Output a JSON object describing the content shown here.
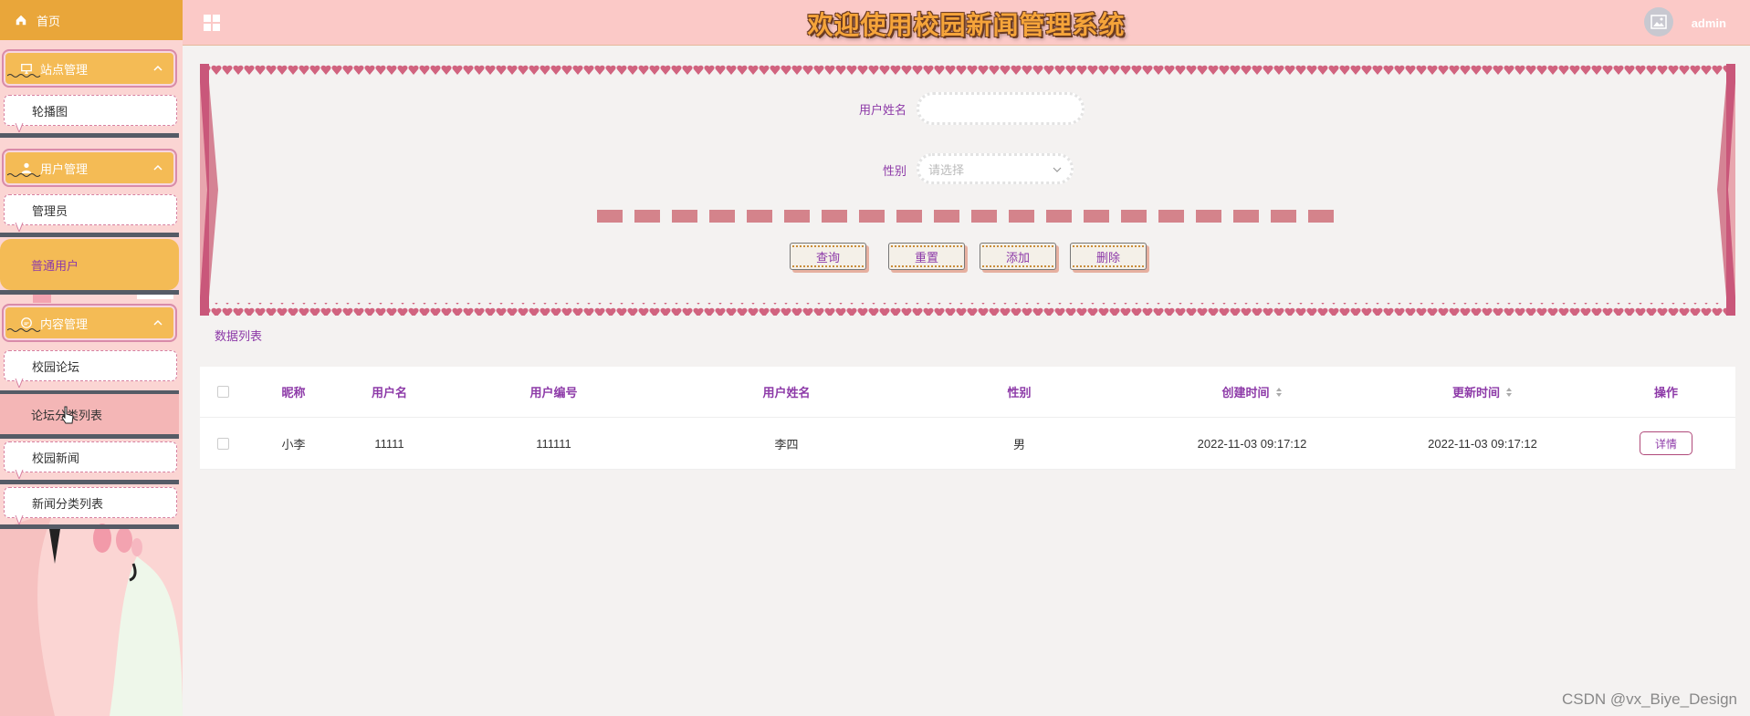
{
  "sidebar": {
    "home": "首页",
    "groups": [
      {
        "label": "站点管理",
        "items": [
          "轮播图"
        ]
      },
      {
        "label": "用户管理",
        "items": [
          "管理员",
          "普通用户"
        ]
      },
      {
        "label": "内容管理",
        "items": [
          "校园论坛",
          "论坛分类列表",
          "校园新闻",
          "新闻分类列表"
        ]
      }
    ],
    "active_item": "普通用户"
  },
  "header": {
    "title": "欢迎使用校园新闻管理系统",
    "username": "admin"
  },
  "search": {
    "name_label": "用户姓名",
    "name_value": "",
    "gender_label": "性别",
    "gender_placeholder": "请选择",
    "buttons": {
      "query": "查询",
      "reset": "重置",
      "add": "添加",
      "delete": "删除"
    }
  },
  "list_title": "数据列表",
  "table": {
    "columns": [
      "昵称",
      "用户名",
      "用户编号",
      "用户姓名",
      "性别",
      "创建时间",
      "更新时间",
      "操作"
    ],
    "rows": [
      {
        "nickname": "小李",
        "username": "11111",
        "user_no": "111111",
        "real_name": "李四",
        "gender": "男",
        "created": "2022-11-03 09:17:12",
        "updated": "2022-11-03 09:17:12",
        "action": "详情"
      }
    ]
  },
  "watermark": "CSDN @vx_Biye_Design",
  "colors": {
    "accent": "#8d3aa8",
    "sidebar_group": "#f4bb55",
    "header_bg": "#fbc9c7",
    "title": "#f5a43a"
  }
}
